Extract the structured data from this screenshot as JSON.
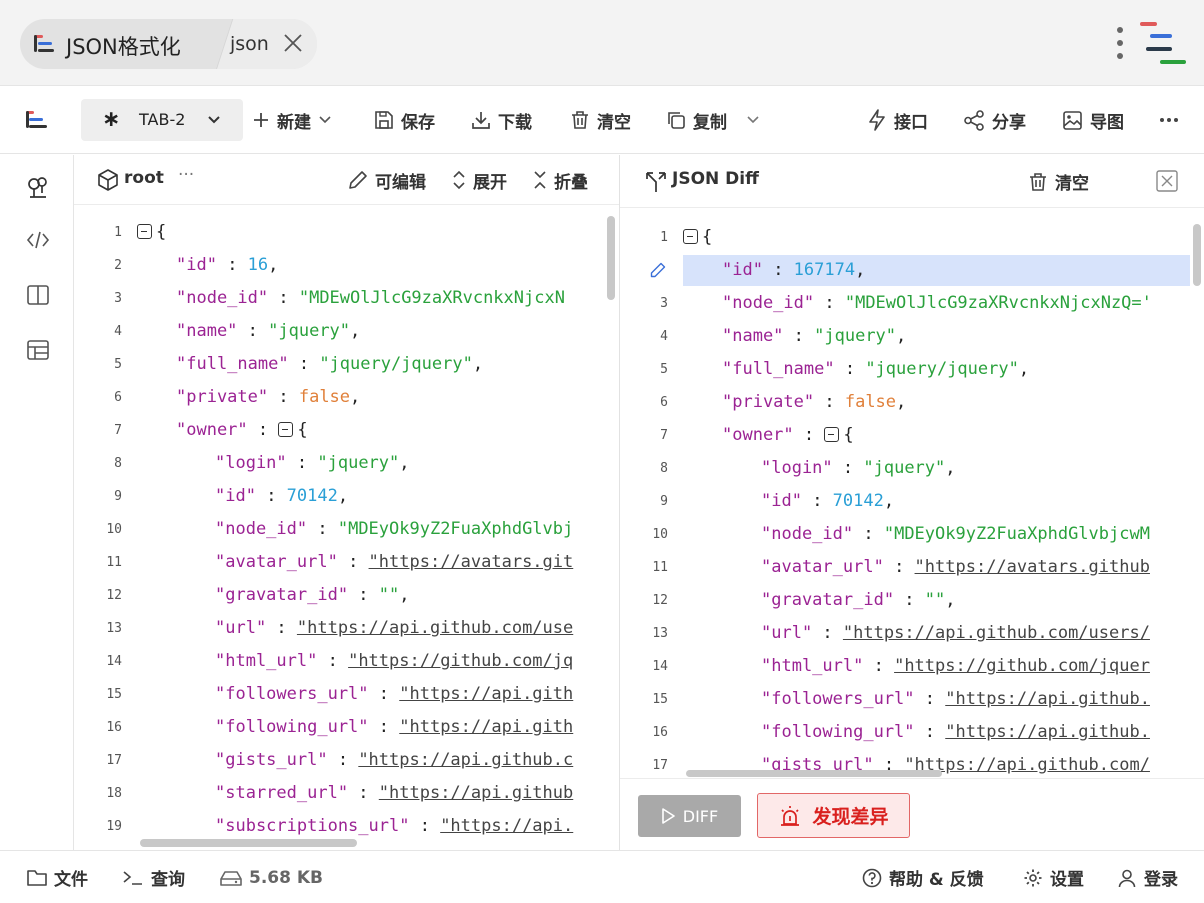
{
  "titlebar": {
    "app_name": "JSON格式化",
    "sub_tab": "json"
  },
  "toolbar": {
    "tab_label": "TAB-2",
    "new_label": "新建",
    "save_label": "保存",
    "download_label": "下载",
    "clear_label": "清空",
    "copy_label": "复制",
    "api_label": "接口",
    "share_label": "分享",
    "export_image_label": "导图"
  },
  "left_panel": {
    "breadcrumb": "root",
    "editable_label": "可编辑",
    "expand_label": "展开",
    "collapse_label": "折叠",
    "lines": [
      {
        "n": "1",
        "indent": 0,
        "parts": [
          {
            "c": "fold",
            "t": ""
          },
          {
            "c": "p",
            "t": "{"
          }
        ]
      },
      {
        "n": "2",
        "indent": 1,
        "parts": [
          {
            "c": "k",
            "t": "\"id\""
          },
          {
            "c": "p",
            "t": " : "
          },
          {
            "c": "n",
            "t": "16"
          },
          {
            "c": "p",
            "t": ","
          }
        ]
      },
      {
        "n": "3",
        "indent": 1,
        "parts": [
          {
            "c": "k",
            "t": "\"node_id\""
          },
          {
            "c": "p",
            "t": " : "
          },
          {
            "c": "s",
            "t": "\"MDEwOlJlcG9zaXRvcnkxNjcxN"
          }
        ]
      },
      {
        "n": "4",
        "indent": 1,
        "parts": [
          {
            "c": "k",
            "t": "\"name\""
          },
          {
            "c": "p",
            "t": " : "
          },
          {
            "c": "s",
            "t": "\"jquery\""
          },
          {
            "c": "p",
            "t": ","
          }
        ]
      },
      {
        "n": "5",
        "indent": 1,
        "parts": [
          {
            "c": "k",
            "t": "\"full_name\""
          },
          {
            "c": "p",
            "t": " : "
          },
          {
            "c": "s",
            "t": "\"jquery/jquery\""
          },
          {
            "c": "p",
            "t": ","
          }
        ]
      },
      {
        "n": "6",
        "indent": 1,
        "parts": [
          {
            "c": "k",
            "t": "\"private\""
          },
          {
            "c": "p",
            "t": " : "
          },
          {
            "c": "b",
            "t": "false"
          },
          {
            "c": "p",
            "t": ","
          }
        ]
      },
      {
        "n": "7",
        "indent": 1,
        "parts": [
          {
            "c": "k",
            "t": "\"owner\""
          },
          {
            "c": "p",
            "t": " : "
          },
          {
            "c": "fold",
            "t": ""
          },
          {
            "c": "p",
            "t": "{"
          }
        ]
      },
      {
        "n": "8",
        "indent": 2,
        "parts": [
          {
            "c": "k",
            "t": "\"login\""
          },
          {
            "c": "p",
            "t": " : "
          },
          {
            "c": "s",
            "t": "\"jquery\""
          },
          {
            "c": "p",
            "t": ","
          }
        ]
      },
      {
        "n": "9",
        "indent": 2,
        "parts": [
          {
            "c": "k",
            "t": "\"id\""
          },
          {
            "c": "p",
            "t": " : "
          },
          {
            "c": "n",
            "t": "70142"
          },
          {
            "c": "p",
            "t": ","
          }
        ]
      },
      {
        "n": "10",
        "indent": 2,
        "parts": [
          {
            "c": "k",
            "t": "\"node_id\""
          },
          {
            "c": "p",
            "t": " : "
          },
          {
            "c": "s",
            "t": "\"MDEyOk9yZ2FuaXphdGlvbj"
          }
        ]
      },
      {
        "n": "11",
        "indent": 2,
        "parts": [
          {
            "c": "k",
            "t": "\"avatar_url\""
          },
          {
            "c": "p",
            "t": " : "
          },
          {
            "c": "u",
            "t": "\"https://avatars.git"
          }
        ]
      },
      {
        "n": "12",
        "indent": 2,
        "parts": [
          {
            "c": "k",
            "t": "\"gravatar_id\""
          },
          {
            "c": "p",
            "t": " : "
          },
          {
            "c": "s",
            "t": "\"\""
          },
          {
            "c": "p",
            "t": ","
          }
        ]
      },
      {
        "n": "13",
        "indent": 2,
        "parts": [
          {
            "c": "k",
            "t": "\"url\""
          },
          {
            "c": "p",
            "t": " : "
          },
          {
            "c": "u",
            "t": "\"https://api.github.com/use"
          }
        ]
      },
      {
        "n": "14",
        "indent": 2,
        "parts": [
          {
            "c": "k",
            "t": "\"html_url\""
          },
          {
            "c": "p",
            "t": " : "
          },
          {
            "c": "u",
            "t": "\"https://github.com/jq"
          }
        ]
      },
      {
        "n": "15",
        "indent": 2,
        "parts": [
          {
            "c": "k",
            "t": "\"followers_url\""
          },
          {
            "c": "p",
            "t": " : "
          },
          {
            "c": "u",
            "t": "\"https://api.gith"
          }
        ]
      },
      {
        "n": "16",
        "indent": 2,
        "parts": [
          {
            "c": "k",
            "t": "\"following_url\""
          },
          {
            "c": "p",
            "t": " : "
          },
          {
            "c": "u",
            "t": "\"https://api.gith"
          }
        ]
      },
      {
        "n": "17",
        "indent": 2,
        "parts": [
          {
            "c": "k",
            "t": "\"gists_url\""
          },
          {
            "c": "p",
            "t": " : "
          },
          {
            "c": "u",
            "t": "\"https://api.github.c"
          }
        ]
      },
      {
        "n": "18",
        "indent": 2,
        "parts": [
          {
            "c": "k",
            "t": "\"starred_url\""
          },
          {
            "c": "p",
            "t": " : "
          },
          {
            "c": "u",
            "t": "\"https://api.github"
          }
        ]
      },
      {
        "n": "19",
        "indent": 2,
        "parts": [
          {
            "c": "k",
            "t": "\"subscriptions_url\""
          },
          {
            "c": "p",
            "t": " : "
          },
          {
            "c": "u",
            "t": "\"https://api."
          }
        ]
      }
    ]
  },
  "right_panel": {
    "title": "JSON Diff",
    "clear_label": "清空",
    "diff_button": "DIFF",
    "diff_result": "发现差异",
    "lines": [
      {
        "n": "1",
        "indent": 0,
        "parts": [
          {
            "c": "fold",
            "t": ""
          },
          {
            "c": "p",
            "t": "{"
          }
        ]
      },
      {
        "n": "",
        "indent": 1,
        "changed": true,
        "parts": [
          {
            "c": "k",
            "t": "\"id\""
          },
          {
            "c": "p",
            "t": " : "
          },
          {
            "c": "n",
            "t": "167174"
          },
          {
            "c": "p",
            "t": ","
          }
        ]
      },
      {
        "n": "3",
        "indent": 1,
        "parts": [
          {
            "c": "k",
            "t": "\"node_id\""
          },
          {
            "c": "p",
            "t": " : "
          },
          {
            "c": "s",
            "t": "\"MDEwOlJlcG9zaXRvcnkxNjcxNzQ='"
          }
        ]
      },
      {
        "n": "4",
        "indent": 1,
        "parts": [
          {
            "c": "k",
            "t": "\"name\""
          },
          {
            "c": "p",
            "t": " : "
          },
          {
            "c": "s",
            "t": "\"jquery\""
          },
          {
            "c": "p",
            "t": ","
          }
        ]
      },
      {
        "n": "5",
        "indent": 1,
        "parts": [
          {
            "c": "k",
            "t": "\"full_name\""
          },
          {
            "c": "p",
            "t": " : "
          },
          {
            "c": "s",
            "t": "\"jquery/jquery\""
          },
          {
            "c": "p",
            "t": ","
          }
        ]
      },
      {
        "n": "6",
        "indent": 1,
        "parts": [
          {
            "c": "k",
            "t": "\"private\""
          },
          {
            "c": "p",
            "t": " : "
          },
          {
            "c": "b",
            "t": "false"
          },
          {
            "c": "p",
            "t": ","
          }
        ]
      },
      {
        "n": "7",
        "indent": 1,
        "parts": [
          {
            "c": "k",
            "t": "\"owner\""
          },
          {
            "c": "p",
            "t": " : "
          },
          {
            "c": "fold",
            "t": ""
          },
          {
            "c": "p",
            "t": "{"
          }
        ]
      },
      {
        "n": "8",
        "indent": 2,
        "parts": [
          {
            "c": "k",
            "t": "\"login\""
          },
          {
            "c": "p",
            "t": " : "
          },
          {
            "c": "s",
            "t": "\"jquery\""
          },
          {
            "c": "p",
            "t": ","
          }
        ]
      },
      {
        "n": "9",
        "indent": 2,
        "parts": [
          {
            "c": "k",
            "t": "\"id\""
          },
          {
            "c": "p",
            "t": " : "
          },
          {
            "c": "n",
            "t": "70142"
          },
          {
            "c": "p",
            "t": ","
          }
        ]
      },
      {
        "n": "10",
        "indent": 2,
        "parts": [
          {
            "c": "k",
            "t": "\"node_id\""
          },
          {
            "c": "p",
            "t": " : "
          },
          {
            "c": "s",
            "t": "\"MDEyOk9yZ2FuaXphdGlvbjcwM"
          }
        ]
      },
      {
        "n": "11",
        "indent": 2,
        "parts": [
          {
            "c": "k",
            "t": "\"avatar_url\""
          },
          {
            "c": "p",
            "t": " : "
          },
          {
            "c": "u",
            "t": "\"https://avatars.github"
          }
        ]
      },
      {
        "n": "12",
        "indent": 2,
        "parts": [
          {
            "c": "k",
            "t": "\"gravatar_id\""
          },
          {
            "c": "p",
            "t": " : "
          },
          {
            "c": "s",
            "t": "\"\""
          },
          {
            "c": "p",
            "t": ","
          }
        ]
      },
      {
        "n": "13",
        "indent": 2,
        "parts": [
          {
            "c": "k",
            "t": "\"url\""
          },
          {
            "c": "p",
            "t": " : "
          },
          {
            "c": "u",
            "t": "\"https://api.github.com/users/"
          }
        ]
      },
      {
        "n": "14",
        "indent": 2,
        "parts": [
          {
            "c": "k",
            "t": "\"html_url\""
          },
          {
            "c": "p",
            "t": " : "
          },
          {
            "c": "u",
            "t": "\"https://github.com/jquer"
          }
        ]
      },
      {
        "n": "15",
        "indent": 2,
        "parts": [
          {
            "c": "k",
            "t": "\"followers_url\""
          },
          {
            "c": "p",
            "t": " : "
          },
          {
            "c": "u",
            "t": "\"https://api.github."
          }
        ]
      },
      {
        "n": "16",
        "indent": 2,
        "parts": [
          {
            "c": "k",
            "t": "\"following_url\""
          },
          {
            "c": "p",
            "t": " : "
          },
          {
            "c": "u",
            "t": "\"https://api.github."
          }
        ]
      },
      {
        "n": "17",
        "indent": 2,
        "parts": [
          {
            "c": "k",
            "t": "\"gists_url\""
          },
          {
            "c": "p",
            "t": " : "
          },
          {
            "c": "u",
            "t": "\"https://api.github.com/"
          }
        ]
      }
    ]
  },
  "statusbar": {
    "file_label": "文件",
    "query_label": "查询",
    "size_label": "5.68 KB",
    "help_label": "帮助 & 反馈",
    "settings_label": "设置",
    "login_label": "登录"
  },
  "colors": {
    "key": "#9b2393",
    "string": "#2aa13c",
    "number": "#2a9fd6",
    "boolean": "#e0803a",
    "diff_highlight": "#d7e3fb",
    "alert_red": "#d9201e"
  }
}
